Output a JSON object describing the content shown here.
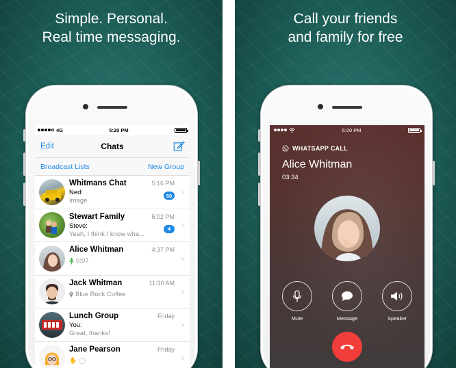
{
  "left_panel": {
    "headline": [
      "Simple. Personal.",
      "Real time messaging."
    ],
    "status_bar": {
      "carrier": "4G",
      "time": "5:20 PM"
    },
    "nav": {
      "edit": "Edit",
      "title": "Chats",
      "compose_icon": "compose-icon"
    },
    "subbar": {
      "broadcast": "Broadcast Lists",
      "new_group": "New Group"
    },
    "chats": [
      {
        "name": "Whitmans Chat",
        "time": "5:16 PM",
        "sender": "Ned:",
        "message": "Image",
        "badge": "50"
      },
      {
        "name": "Stewart Family",
        "time": "5:02 PM",
        "sender": "Steve:",
        "message": "Yeah, I think I know wha...",
        "badge": "4"
      },
      {
        "name": "Alice Whitman",
        "time": "4:37 PM",
        "sender": "",
        "message": "0:07",
        "icon": "microphone-icon"
      },
      {
        "name": "Jack Whitman",
        "time": "11:30 AM",
        "sender": "",
        "message": "Blue Rock Coffee",
        "icon": "location-pin-icon"
      },
      {
        "name": "Lunch Group",
        "time": "Friday",
        "sender": "You:",
        "message": "Great, thanks!"
      },
      {
        "name": "Jane Pearson",
        "time": "Friday",
        "sender": "",
        "message": ""
      }
    ]
  },
  "right_panel": {
    "headline": [
      "Call your friends",
      "and family for free"
    ],
    "status_bar": {
      "time": "5:20 PM"
    },
    "call": {
      "label": "WHATSAPP CALL",
      "name": "Alice Whitman",
      "duration": "03:34",
      "actions": [
        {
          "label": "Mute",
          "icon": "microphone-icon"
        },
        {
          "label": "Message",
          "icon": "message-bubble-icon"
        },
        {
          "label": "Speaker",
          "icon": "speaker-icon"
        }
      ],
      "end_icon": "end-call-icon"
    }
  },
  "colors": {
    "accent": "#1e88e5",
    "background": "#1c5c56",
    "end_call": "#f23e3a"
  }
}
